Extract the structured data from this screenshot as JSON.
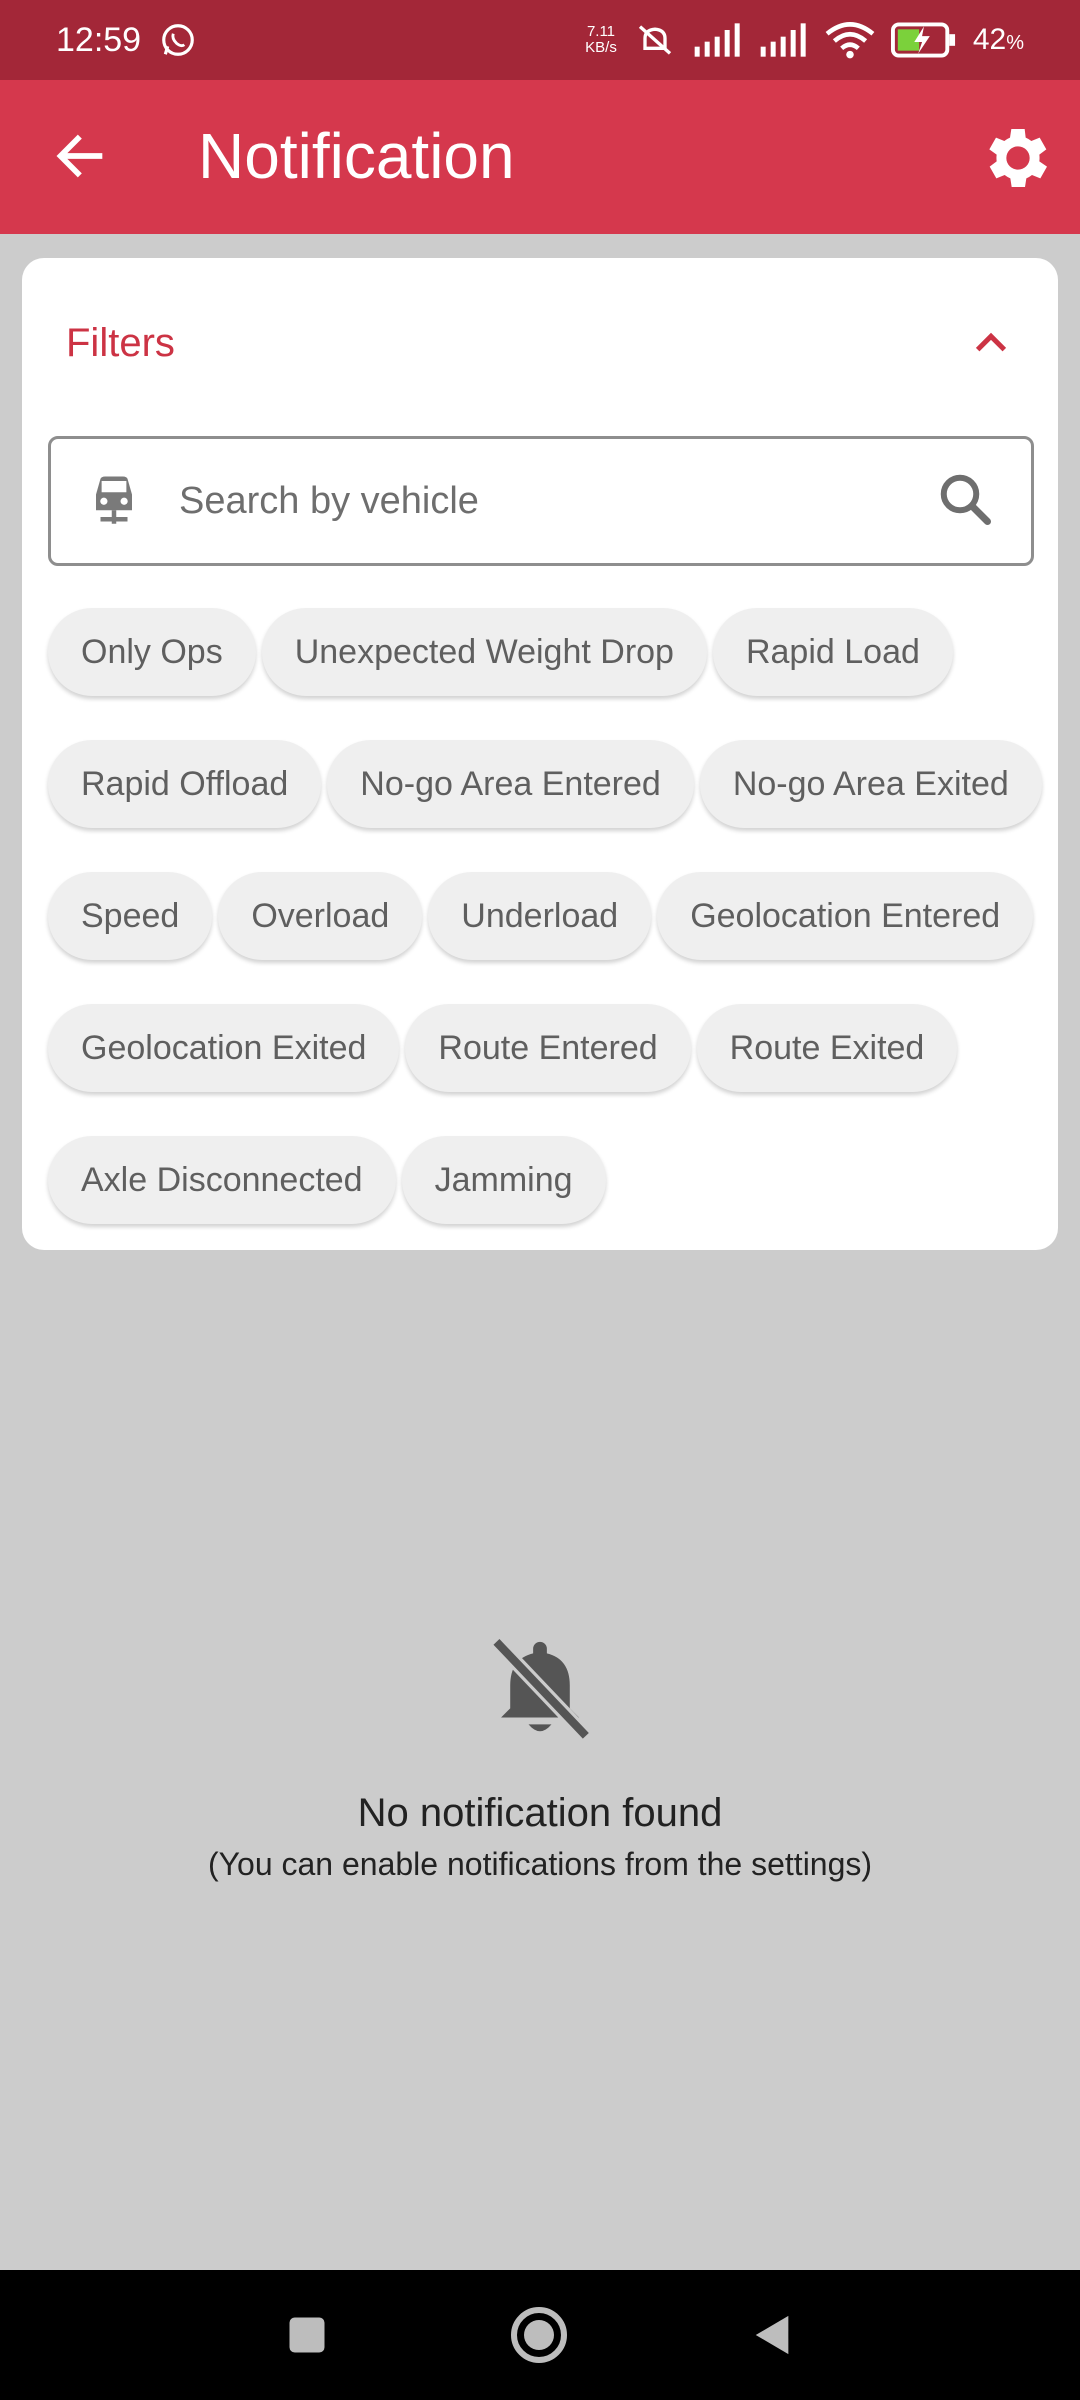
{
  "status_bar": {
    "time": "12:59",
    "net_speed_value": "7.11",
    "net_speed_unit": "KB/s",
    "battery_value": "42",
    "battery_unit": "%"
  },
  "app_bar": {
    "title": "Notification",
    "back_icon": "arrow-left-icon",
    "settings_icon": "gear-icon"
  },
  "filters": {
    "label": "Filters",
    "expanded": true,
    "search": {
      "placeholder": "Search by vehicle",
      "value": ""
    },
    "chips": [
      "Only Ops",
      "Unexpected Weight Drop",
      "Rapid Load",
      "Rapid Offload",
      "No-go Area Entered",
      "No-go Area Exited",
      "Speed",
      "Overload",
      "Underload",
      "Geolocation Entered",
      "Geolocation Exited",
      "Route Entered",
      "Route Exited",
      "Axle Disconnected",
      "Jamming"
    ]
  },
  "empty_state": {
    "icon": "bell-off-icon",
    "title": "No notification found",
    "subtitle": "(You can enable notifications from the settings)"
  },
  "colors": {
    "status_bar": "#a32738",
    "app_bar": "#d5384d",
    "accent": "#cc3344",
    "background": "#cccccc"
  }
}
